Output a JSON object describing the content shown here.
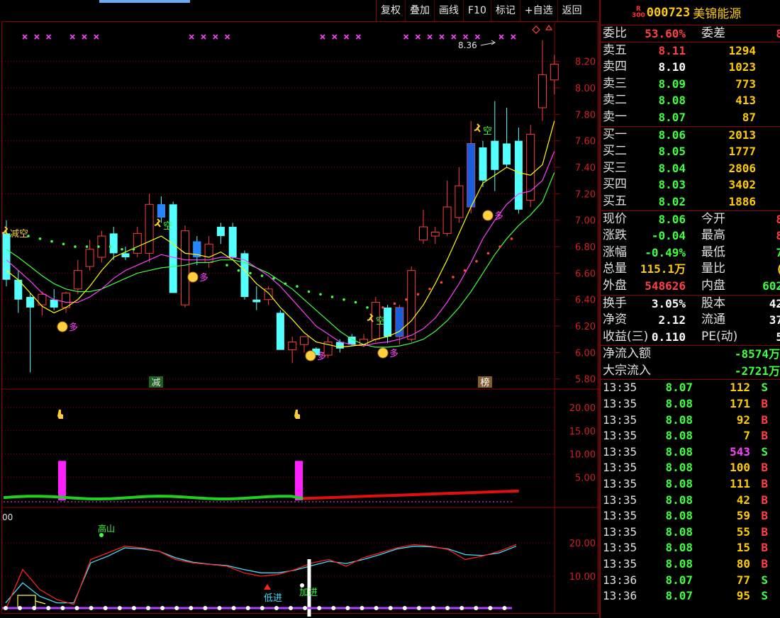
{
  "toolbar": {
    "items": [
      "复权",
      "叠加",
      "画线",
      "F10",
      "标记",
      "+自选",
      "返回"
    ]
  },
  "chart": {
    "price_axis": [
      "8.20",
      "8.00",
      "7.80",
      "7.60",
      "7.40",
      "7.20",
      "7.00",
      "6.80",
      "6.60",
      "6.40",
      "6.20",
      "6.00",
      "5.80"
    ],
    "vol_axis": [
      "20.00",
      "15.00",
      "10.00",
      "5.00"
    ],
    "osc_axis": [
      "20.00",
      "10.00"
    ],
    "osc_corner_label": "00",
    "high_annotation": "8.36",
    "marker_jian": "减",
    "marker_bang": "榜",
    "signal_kong": "空",
    "signal_duo": "多",
    "signal_jiankong": "减空",
    "signal_gaoshan": "高山",
    "signal_dijin": "低进",
    "signal_jiajin": "加进",
    "colors": {
      "up": "#ff3c3c",
      "down": "#54ffff",
      "ma5": "#ffff00",
      "ma10": "#ff40ff",
      "ma20": "#40ff40",
      "grid": "#8b0000",
      "accent": "#ffcc00"
    }
  },
  "chart_data": {
    "type": "candlestick",
    "ylim": [
      5.75,
      8.36
    ],
    "candles": [
      {
        "o": 6.9,
        "h": 7.0,
        "l": 6.5,
        "c": 6.55
      },
      {
        "o": 6.55,
        "h": 6.62,
        "l": 6.3,
        "c": 6.4
      },
      {
        "o": 6.42,
        "h": 6.45,
        "l": 5.85,
        "c": 6.34
      },
      {
        "o": 6.36,
        "h": 6.46,
        "l": 6.28,
        "c": 6.44
      },
      {
        "o": 6.4,
        "h": 6.48,
        "l": 6.32,
        "c": 6.34
      },
      {
        "o": 6.34,
        "h": 6.46,
        "l": 6.3,
        "c": 6.45
      },
      {
        "o": 6.48,
        "h": 6.7,
        "l": 6.44,
        "c": 6.62
      },
      {
        "o": 6.65,
        "h": 6.85,
        "l": 6.62,
        "c": 6.78
      },
      {
        "o": 6.72,
        "h": 6.92,
        "l": 6.68,
        "c": 6.88
      },
      {
        "o": 6.9,
        "h": 6.95,
        "l": 6.7,
        "c": 6.75
      },
      {
        "o": 6.75,
        "h": 6.8,
        "l": 6.7,
        "c": 6.72
      },
      {
        "o": 6.75,
        "h": 6.95,
        "l": 6.72,
        "c": 6.9
      },
      {
        "o": 6.75,
        "h": 7.2,
        "l": 6.68,
        "c": 7.12
      },
      {
        "o": 7.12,
        "h": 7.18,
        "l": 6.98,
        "c": 7.02
      },
      {
        "o": 7.12,
        "h": 7.14,
        "l": 6.45,
        "c": 6.45
      },
      {
        "o": 6.36,
        "h": 6.96,
        "l": 6.34,
        "c": 6.92
      },
      {
        "o": 6.84,
        "h": 6.88,
        "l": 6.66,
        "c": 6.72
      },
      {
        "o": 6.68,
        "h": 6.88,
        "l": 6.64,
        "c": 6.82
      },
      {
        "o": 6.95,
        "h": 6.98,
        "l": 6.82,
        "c": 6.88
      },
      {
        "o": 6.95,
        "h": 6.98,
        "l": 6.7,
        "c": 6.72
      },
      {
        "o": 6.75,
        "h": 6.77,
        "l": 6.4,
        "c": 6.42
      },
      {
        "o": 6.4,
        "h": 6.5,
        "l": 6.32,
        "c": 6.38
      },
      {
        "o": 6.4,
        "h": 6.5,
        "l": 6.36,
        "c": 6.48
      },
      {
        "o": 6.3,
        "h": 6.32,
        "l": 6.02,
        "c": 6.02
      },
      {
        "o": 6.02,
        "h": 6.12,
        "l": 5.92,
        "c": 6.08
      },
      {
        "o": 6.06,
        "h": 6.12,
        "l": 6.0,
        "c": 6.12
      },
      {
        "o": 6.03,
        "h": 6.04,
        "l": 5.98,
        "c": 5.98
      },
      {
        "o": 5.98,
        "h": 6.12,
        "l": 5.96,
        "c": 6.08
      },
      {
        "o": 6.08,
        "h": 6.1,
        "l": 6.0,
        "c": 6.03
      },
      {
        "o": 6.12,
        "h": 6.14,
        "l": 6.05,
        "c": 6.06
      },
      {
        "o": 6.06,
        "h": 6.14,
        "l": 6.04,
        "c": 6.1
      },
      {
        "o": 6.1,
        "h": 6.42,
        "l": 6.08,
        "c": 6.38
      },
      {
        "o": 6.34,
        "h": 6.36,
        "l": 6.07,
        "c": 6.12
      },
      {
        "o": 6.12,
        "h": 6.36,
        "l": 6.06,
        "c": 6.34
      },
      {
        "o": 6.1,
        "h": 6.65,
        "l": 6.08,
        "c": 6.62
      },
      {
        "o": 6.85,
        "h": 7.08,
        "l": 6.82,
        "c": 6.95
      },
      {
        "o": 6.88,
        "h": 6.95,
        "l": 6.82,
        "c": 6.91
      },
      {
        "o": 6.9,
        "h": 7.3,
        "l": 6.88,
        "c": 7.1
      },
      {
        "o": 7.02,
        "h": 7.4,
        "l": 6.98,
        "c": 7.26
      },
      {
        "o": 7.1,
        "h": 7.75,
        "l": 7.05,
        "c": 7.58
      },
      {
        "o": 7.55,
        "h": 7.6,
        "l": 7.25,
        "c": 7.3
      },
      {
        "o": 7.6,
        "h": 7.9,
        "l": 7.22,
        "c": 7.38
      },
      {
        "o": 7.58,
        "h": 7.85,
        "l": 7.4,
        "c": 7.42
      },
      {
        "o": 7.6,
        "h": 7.7,
        "l": 7.05,
        "c": 7.08
      },
      {
        "o": 7.15,
        "h": 7.72,
        "l": 7.1,
        "c": 7.65
      },
      {
        "o": 7.85,
        "h": 8.36,
        "l": 7.75,
        "c": 8.1
      },
      {
        "o": 8.06,
        "h": 8.25,
        "l": 7.95,
        "c": 8.18
      }
    ],
    "ma5": [
      6.62,
      6.55,
      6.45,
      6.35,
      6.3,
      6.34,
      6.4,
      6.5,
      6.62,
      6.72,
      6.76,
      6.8,
      6.84,
      6.88,
      6.82,
      6.75,
      6.74,
      6.72,
      6.76,
      6.7,
      6.62,
      6.52,
      6.45,
      6.34,
      6.25,
      6.15,
      6.08,
      6.06,
      6.04,
      6.05,
      6.06,
      6.1,
      6.12,
      6.16,
      6.24,
      6.36,
      6.52,
      6.7,
      6.9,
      7.1,
      7.28,
      7.34,
      7.4,
      7.36,
      7.34,
      7.42,
      7.75
    ],
    "ma10": [
      6.7,
      6.62,
      6.54,
      6.45,
      6.4,
      6.38,
      6.38,
      6.42,
      6.48,
      6.56,
      6.62,
      6.66,
      6.7,
      6.74,
      6.72,
      6.7,
      6.7,
      6.7,
      6.72,
      6.72,
      6.7,
      6.64,
      6.58,
      6.5,
      6.4,
      6.3,
      6.2,
      6.14,
      6.08,
      6.06,
      6.05,
      6.07,
      6.08,
      6.1,
      6.13,
      6.18,
      6.26,
      6.38,
      6.52,
      6.68,
      6.86,
      7.0,
      7.12,
      7.2,
      7.22,
      7.3,
      7.52
    ],
    "ma20": [
      6.78,
      6.72,
      6.65,
      6.58,
      6.52,
      6.48,
      6.46,
      6.46,
      6.48,
      6.52,
      6.56,
      6.6,
      6.62,
      6.64,
      6.65,
      6.66,
      6.68,
      6.68,
      6.7,
      6.7,
      6.68,
      6.64,
      6.6,
      6.54,
      6.48,
      6.4,
      6.32,
      6.24,
      6.16,
      6.1,
      6.06,
      6.04,
      6.04,
      6.05,
      6.07,
      6.1,
      6.16,
      6.24,
      6.34,
      6.46,
      6.6,
      6.74,
      6.86,
      6.96,
      7.04,
      7.14,
      7.36
    ],
    "dots_left": [
      6.88,
      6.86,
      6.84,
      6.82,
      6.8,
      6.8,
      6.8,
      6.8,
      6.78,
      6.78
    ],
    "dots_mid": [
      6.66,
      6.62,
      6.6,
      6.58,
      6.56,
      6.52,
      6.5,
      6.46,
      6.44,
      6.42,
      6.4,
      6.38,
      6.34
    ],
    "dots_right": [
      6.34,
      6.37,
      6.4,
      6.44,
      6.48,
      6.53,
      6.57,
      6.62,
      6.69,
      6.75,
      6.8,
      6.86
    ],
    "vol_axis_range": [
      0,
      23
    ],
    "spikes": [
      8,
      8
    ]
  },
  "quote": {
    "badge": "R\n300",
    "code": "000723",
    "name": "美锦能源",
    "weibi_label": "委比",
    "weibi": "53.60%",
    "weicha_label": "委差",
    "weicha": "8",
    "sells": [
      {
        "label": "卖五",
        "price": "8.11",
        "vol": "1294",
        "pc": "#ff4040"
      },
      {
        "label": "卖四",
        "price": "8.10",
        "vol": "1023",
        "pc": "#ffffff"
      },
      {
        "label": "卖三",
        "price": "8.09",
        "vol": "773",
        "pc": "#40ff40"
      },
      {
        "label": "卖二",
        "price": "8.08",
        "vol": "413",
        "pc": "#40ff40"
      },
      {
        "label": "卖一",
        "price": "8.07",
        "vol": "87",
        "pc": "#40ff40"
      }
    ],
    "buys": [
      {
        "label": "买一",
        "price": "8.06",
        "vol": "2013",
        "pc": "#40ff40"
      },
      {
        "label": "买二",
        "price": "8.05",
        "vol": "1777",
        "pc": "#40ff40"
      },
      {
        "label": "买三",
        "price": "8.04",
        "vol": "2806",
        "pc": "#40ff40"
      },
      {
        "label": "买四",
        "price": "8.03",
        "vol": "3402",
        "pc": "#40ff40"
      },
      {
        "label": "买五",
        "price": "8.02",
        "vol": "1886",
        "pc": "#40ff40"
      }
    ],
    "stats1": [
      {
        "l1": "现价",
        "v1": "8.06",
        "c1": "#40ff40",
        "l2": "今开",
        "v2": "8",
        "c2": "#ff4040"
      },
      {
        "l1": "涨跌",
        "v1": "-0.04",
        "c1": "#40ff40",
        "l2": "最高",
        "v2": "8",
        "c2": "#ff4040"
      },
      {
        "l1": "涨幅",
        "v1": "-0.49%",
        "c1": "#40ff40",
        "l2": "最低",
        "v2": "7",
        "c2": "#40ff40"
      },
      {
        "l1": "总量",
        "v1": "115.1万",
        "c1": "#ffcc00",
        "l2": "量比",
        "v2": "(",
        "c2": "#ffcc00"
      },
      {
        "l1": "外盘",
        "v1": "548626",
        "c1": "#ff4040",
        "l2": "内盘",
        "v2": "602",
        "c2": "#40ff40"
      }
    ],
    "stats2": [
      {
        "l1": "换手",
        "v1": "3.05%",
        "c1": "#ffffff",
        "l2": "股本",
        "v2": "42",
        "c2": "#ffffff"
      },
      {
        "l1": "净资",
        "v1": "2.12",
        "c1": "#ffffff",
        "l2": "流通",
        "v2": "37",
        "c2": "#ffffff"
      },
      {
        "l1": "收益(三)",
        "v1": "0.110",
        "c1": "#ffffff",
        "l2": "PE(动)",
        "v2": "5",
        "c2": "#ffffff"
      }
    ],
    "flows": [
      {
        "l": "净流入额",
        "v": "-8574万",
        "c": "#40ff40"
      },
      {
        "l": "大宗流入",
        "v": "-2721万",
        "c": "#40ff40"
      }
    ],
    "ticks": [
      {
        "t": "13:35",
        "p": "8.07",
        "v": "112",
        "s": "S"
      },
      {
        "t": "13:35",
        "p": "8.08",
        "v": "171",
        "s": "B"
      },
      {
        "t": "13:35",
        "p": "8.08",
        "v": "92",
        "s": "B"
      },
      {
        "t": "13:35",
        "p": "8.08",
        "v": "7",
        "s": "B"
      },
      {
        "t": "13:35",
        "p": "8.08",
        "v": "543",
        "s": "S"
      },
      {
        "t": "13:35",
        "p": "8.08",
        "v": "100",
        "s": "B"
      },
      {
        "t": "13:35",
        "p": "8.08",
        "v": "111",
        "s": "B"
      },
      {
        "t": "13:35",
        "p": "8.08",
        "v": "42",
        "s": "B"
      },
      {
        "t": "13:35",
        "p": "8.08",
        "v": "59",
        "s": "B"
      },
      {
        "t": "13:35",
        "p": "8.08",
        "v": "55",
        "s": "B"
      },
      {
        "t": "13:35",
        "p": "8.08",
        "v": "15",
        "s": "B"
      },
      {
        "t": "13:35",
        "p": "8.08",
        "v": "80",
        "s": "B"
      },
      {
        "t": "13:36",
        "p": "8.07",
        "v": "77",
        "s": "S"
      },
      {
        "t": "13:36",
        "p": "8.07",
        "v": "95",
        "s": "S"
      }
    ]
  }
}
